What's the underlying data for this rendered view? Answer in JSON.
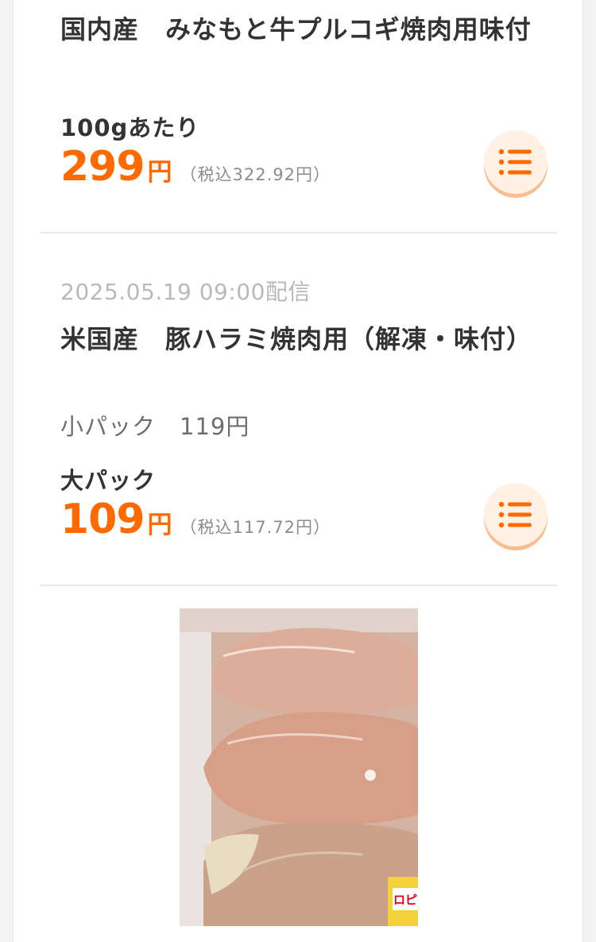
{
  "items": [
    {
      "title": "国内産　みなもと牛プルコギ焼肉用味付",
      "unit_label": "100gあたり",
      "price": "299",
      "yen": "円",
      "tax_price": "（税込322.92円）",
      "list_button_icon": "list-icon"
    },
    {
      "date": "2025.05.19 09:00配信",
      "title": "米国産　豚ハラミ焼肉用（解凍・味付）",
      "small_pack": "小パック　119円",
      "unit_label": "大パック",
      "price": "109",
      "yen": "円",
      "tax_price": "（税込117.72円）",
      "list_button_icon": "list-icon"
    }
  ],
  "photo": {
    "label_fragment": "ロピ",
    "accent": "#ff6a00"
  }
}
